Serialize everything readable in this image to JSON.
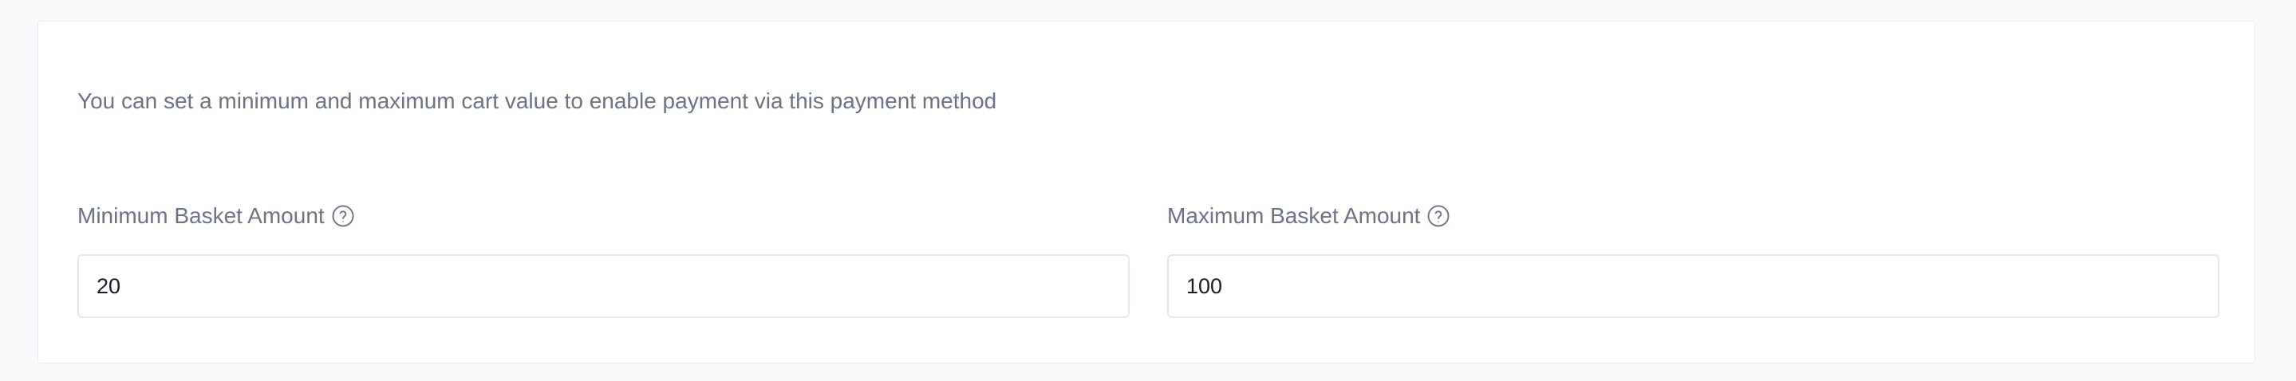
{
  "settings": {
    "description": "You can set a minimum and maximum cart value to enable payment via this payment method",
    "min_basket": {
      "label": "Minimum Basket Amount",
      "value": "20",
      "help_icon": "question-circle-icon"
    },
    "max_basket": {
      "label": "Maximum Basket Amount",
      "value": "100",
      "help_icon": "question-circle-icon"
    }
  },
  "colors": {
    "page_background": "#f8f9fb",
    "card_background": "#ffffff",
    "label_text": "#6b7385",
    "input_border": "#e3e6eb"
  }
}
